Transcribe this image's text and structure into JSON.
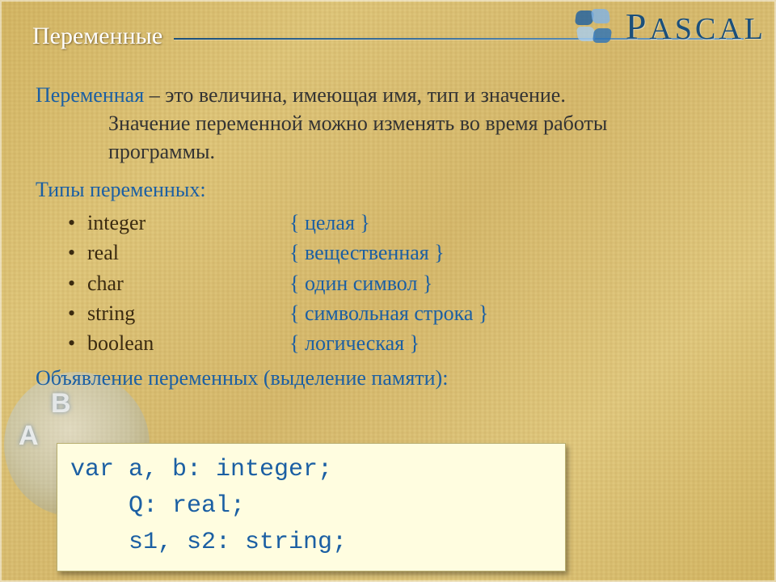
{
  "header": {
    "title": "Переменные",
    "brand": "PASCAL"
  },
  "definition": {
    "term": "Переменная",
    "dash": " – ",
    "text1": "это величина, имеющая имя, тип и значение.",
    "text2": "Значение переменной можно изменять во время работы",
    "text3": "программы."
  },
  "types_heading": "Типы переменных:",
  "types": [
    {
      "name": "integer",
      "comment": "{ целая }"
    },
    {
      "name": "real",
      "comment": "{ вещественная }"
    },
    {
      "name": "char",
      "comment": "{ один символ }"
    },
    {
      "name": "string",
      "comment": "{ символьная строка }"
    },
    {
      "name": "boolean",
      "comment": "{ логическая }"
    }
  ],
  "declaration_heading": "Объявление переменных (выделение памяти):",
  "code": {
    "l1": "var a, b: integer;",
    "l2": "    Q: real;",
    "l3": "    s1, s2: string;"
  },
  "bullet": "•"
}
